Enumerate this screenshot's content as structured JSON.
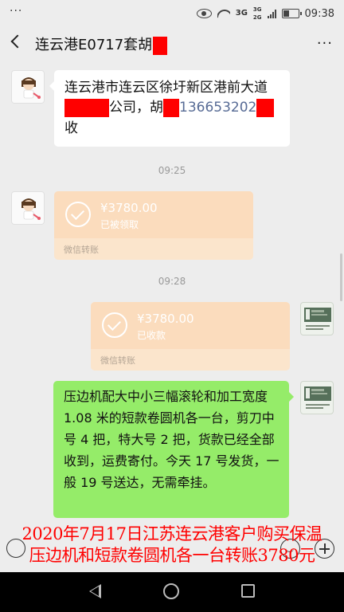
{
  "status_bar": {
    "dots": "···",
    "network_main": "3G",
    "network_sub1": "3G",
    "network_sub2": "2G",
    "time": "09:38"
  },
  "header": {
    "title": "连云港E0717套胡",
    "more": "···"
  },
  "messages": {
    "m1": {
      "line1": "连云港市连云区徐圩新区港前大道",
      "company_suffix": "公司，胡",
      "phone": "136653202",
      "line3": "收"
    },
    "time1": "09:25",
    "m2": {
      "amount": "¥3780.00",
      "status": "已被领取",
      "footer": "微信转账"
    },
    "time2": "09:28",
    "m3": {
      "amount": "¥3780.00",
      "status": "已收款",
      "footer": "微信转账"
    },
    "m4": {
      "text": "压边机配大中小三幅滚轮和加工宽度 1.08 米的短款卷圆机各一台，剪刀中号 4 把，特大号 2 把，货款已经全部收到，运费寄付。今天 17 号发货，一般 19 号送达，无需牵挂。"
    }
  },
  "caption": {
    "line1": "2020年7月17日江苏连云港客户购买保温",
    "line2": "压边机和短款卷圆机各一台转账3780元"
  },
  "colors": {
    "accent_green": "#95ec69",
    "transfer_orange": "#fbdcbd",
    "redaction": "#ff0000",
    "caption_red": "#ff0000",
    "link_blue": "#576b95"
  }
}
